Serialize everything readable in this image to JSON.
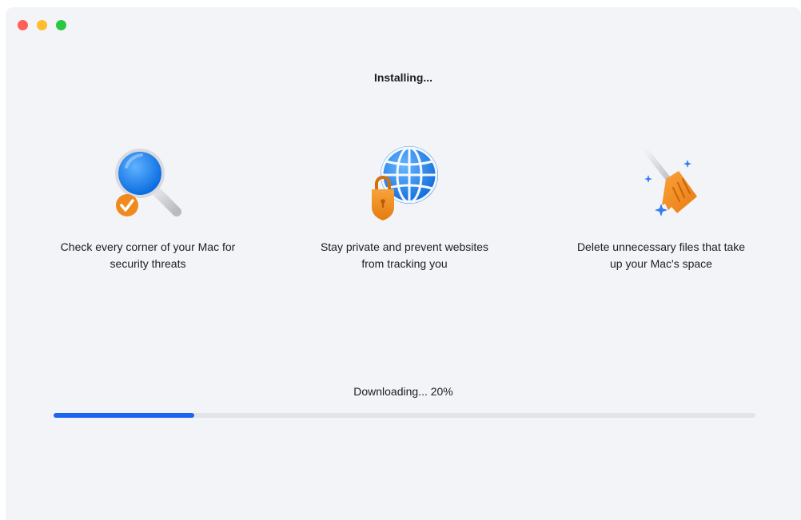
{
  "window": {
    "controls": {
      "close_color": "#fe5f57",
      "minimize_color": "#febc2e",
      "zoom_color": "#28c840"
    }
  },
  "header": {
    "title": "Installing..."
  },
  "features": [
    {
      "icon": "magnifier-check-icon",
      "text": "Check every corner of your Mac for\nsecurity threats"
    },
    {
      "icon": "globe-lock-icon",
      "text": "Stay private and prevent websites\nfrom tracking you"
    },
    {
      "icon": "broom-sparkle-icon",
      "text": "Delete unnecessary files that take\nup your Mac's space"
    }
  ],
  "download": {
    "status": "Downloading... 20%",
    "progress_percent": 20,
    "accent_color": "#1a66f0"
  }
}
